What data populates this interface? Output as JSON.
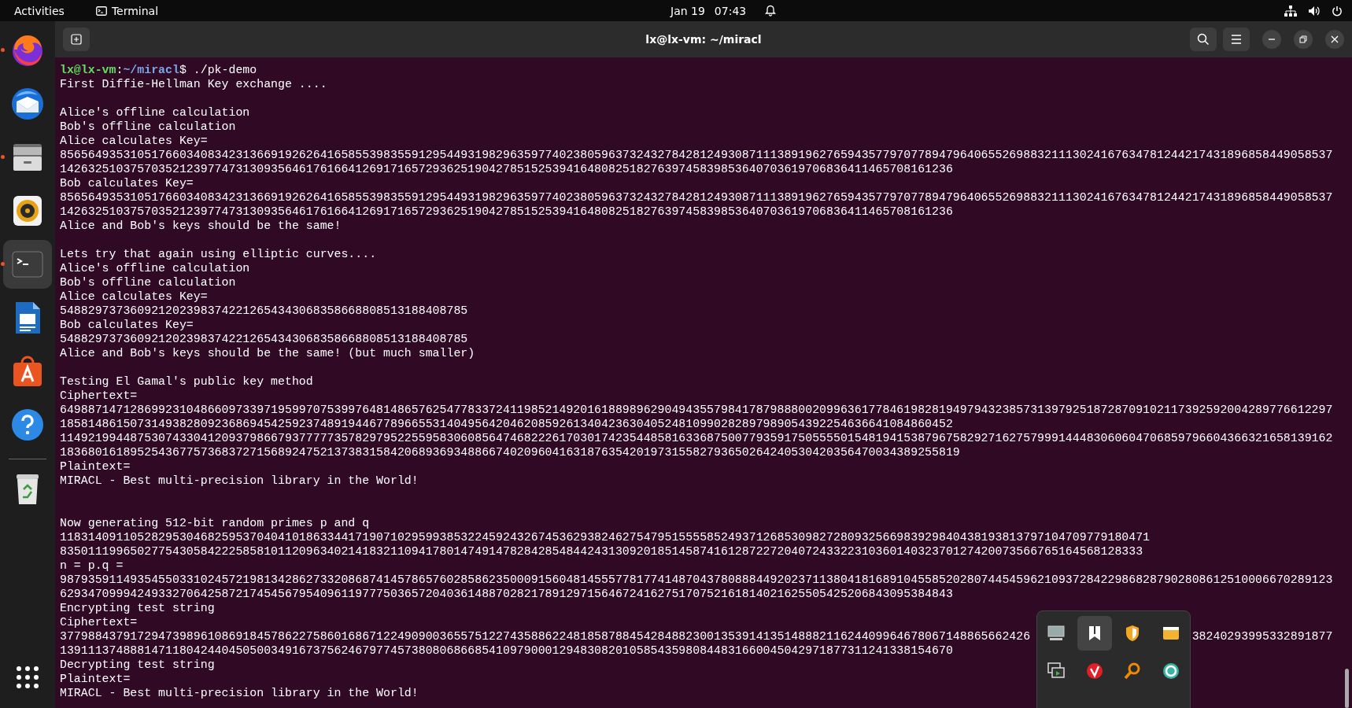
{
  "top_bar": {
    "activities": "Activities",
    "app_name": "Terminal",
    "date": "Jan 19",
    "time": "07:43"
  },
  "dock": {
    "items": [
      {
        "kind": "browser",
        "running": true,
        "selected": false
      },
      {
        "kind": "mail",
        "running": false,
        "selected": false
      },
      {
        "kind": "files",
        "running": true,
        "selected": false
      },
      {
        "kind": "music",
        "running": false,
        "selected": false
      },
      {
        "kind": "terminal",
        "running": true,
        "selected": true
      },
      {
        "kind": "writer",
        "running": false,
        "selected": false
      },
      {
        "kind": "store",
        "running": false,
        "selected": false
      },
      {
        "kind": "help",
        "running": false,
        "selected": false
      },
      {
        "kind": "trash",
        "running": false,
        "selected": false
      }
    ]
  },
  "window": {
    "title": "lx@lx-vm: ~/miracl"
  },
  "terminal": {
    "lines": [
      {
        "kind": "prompt",
        "user": "lx@lx-vm",
        "separator": ":",
        "path": "~/miracl",
        "command": "$ ./pk-demo"
      },
      {
        "kind": "output",
        "segments": [
          "First Diffie-Hellman Key exchange ...."
        ]
      },
      {
        "kind": "blank"
      },
      {
        "kind": "output",
        "segments": [
          "Alice's offline calculation"
        ]
      },
      {
        "kind": "output",
        "segments": [
          "Bob's offline calculation"
        ]
      },
      {
        "kind": "output",
        "segments": [
          "Alice calculates Key="
        ]
      },
      {
        "kind": "output",
        "segments": [
          "8565649353105176603408342313669192626416585539835591295449319829635977402380596373243278428124930871113891962765943577970778947964065526988321113024167634781244217431896858449058537"
        ]
      },
      {
        "kind": "output",
        "segments": [
          "1426325103757035212397747313093564617616641269171657293625190427851525394164808251827639745839853640703619706836411465708161236"
        ]
      },
      {
        "kind": "output",
        "segments": [
          "Bob calculates Key="
        ]
      },
      {
        "kind": "output",
        "segments": [
          "8565649353105176603408342313669192626416585539835591295449319829635977402380596373243278428124930871113891962765943577970778947964065526988321113024167634781244217431896858449058537"
        ]
      },
      {
        "kind": "output",
        "segments": [
          "1426325103757035212397747313093564617616641269171657293625190427851525394164808251827639745839853640703619706836411465708161236"
        ]
      },
      {
        "kind": "output",
        "segments": [
          "Alice and Bob's keys should be the same!"
        ]
      },
      {
        "kind": "blank"
      },
      {
        "kind": "output",
        "segments": [
          "Lets try that again using elliptic curves...."
        ]
      },
      {
        "kind": "output",
        "segments": [
          "Alice's offline calculation"
        ]
      },
      {
        "kind": "output",
        "segments": [
          "Bob's offline calculation"
        ]
      },
      {
        "kind": "output",
        "segments": [
          "Alice calculates Key="
        ]
      },
      {
        "kind": "output",
        "segments": [
          "5488297373609212023983742212654343068358668808513188408785"
        ]
      },
      {
        "kind": "output",
        "segments": [
          "Bob calculates Key="
        ]
      },
      {
        "kind": "output",
        "segments": [
          "5488297373609212023983742212654343068358668808513188408785"
        ]
      },
      {
        "kind": "output",
        "segments": [
          "Alice and Bob's keys should be the same! (but much smaller)"
        ]
      },
      {
        "kind": "blank"
      },
      {
        "kind": "output",
        "segments": [
          "Testing El Gamal's public key method"
        ]
      },
      {
        "kind": "output",
        "segments": [
          "Ciphertext="
        ]
      },
      {
        "kind": "output",
        "segments": [
          "6498871471286992310486609733971959970753997648148657625477833724119852149201618898962904943557984178798880020996361778461982819497943238573139792518728709102117392592004289776612297"
        ]
      },
      {
        "kind": "output",
        "segments": [
          "1858148615073149382809236869454259237489194467789665531404956420462085926134042363040524810990282897989054392254636641084860452"
        ]
      },
      {
        "kind": "output",
        "segments": [
          "1149219944875307433041209379866793777773578297952255958306085647468222617030174235448581633687500779359175055550154819415387967582927162757999144483060604706859796604366321658139162"
        ]
      },
      {
        "kind": "output",
        "segments": [
          "18368016189525436775736837271568924752137383158420689369348866740209604163187635420197315582793650264240530420356470034389255819"
        ]
      },
      {
        "kind": "output",
        "segments": [
          "Plaintext="
        ]
      },
      {
        "kind": "output",
        "segments": [
          "MIRACL - Best multi-precision library in the World!"
        ]
      },
      {
        "kind": "blank"
      },
      {
        "kind": "blank"
      },
      {
        "kind": "output",
        "segments": [
          "Now generating 512-bit random primes p and q"
        ]
      },
      {
        "kind": "output",
        "segments": [
          "11831409110528295304682595370404101863344171907102959938532245924326745362938246275479515555852493712685309827280932566983929840438193813797104709779180471"
        ]
      },
      {
        "kind": "output",
        "segments": [
          "8350111996502775430584222585810112096340214183211094178014749147828428548442431309201851458741612872272040724332231036014032370127420073566765164568128333"
        ]
      },
      {
        "kind": "output",
        "segments": [
          "n = p.q ="
        ]
      },
      {
        "kind": "output",
        "segments": [
          "9879359114935455033102457219813428627332086874145786576028586235000915604814555778177414870437808884492023711380418168910455852028074454596210937284229868287902808612510006670289123"
        ]
      },
      {
        "kind": "output",
        "segments": [
          "6293470999424933270642587217454567954096119777503657204036148870282178912971564672416275170752161814021625505425206843095384843"
        ]
      },
      {
        "kind": "output",
        "segments": [
          "Encrypting test string"
        ]
      },
      {
        "kind": "output",
        "segments": [
          "Ciphertext="
        ]
      },
      {
        "kind": "output",
        "segments": [
          "377988437917294739896108691845786227586016867122490900365575122743588622481858788454284882300135391413514888211624409964678067148865662426",
          "38240293995332891877"
        ]
      },
      {
        "kind": "output",
        "segments": [
          "1391113748881471180424404505003491673756246797745738080686685410979000129483082010585435980844831660045042971877311241338154670"
        ]
      },
      {
        "kind": "output",
        "segments": [
          "Decrypting test string"
        ]
      },
      {
        "kind": "output",
        "segments": [
          "Plaintext="
        ]
      },
      {
        "kind": "output",
        "segments": [
          "MIRACL - Best multi-precision library in the World!"
        ]
      }
    ]
  }
}
